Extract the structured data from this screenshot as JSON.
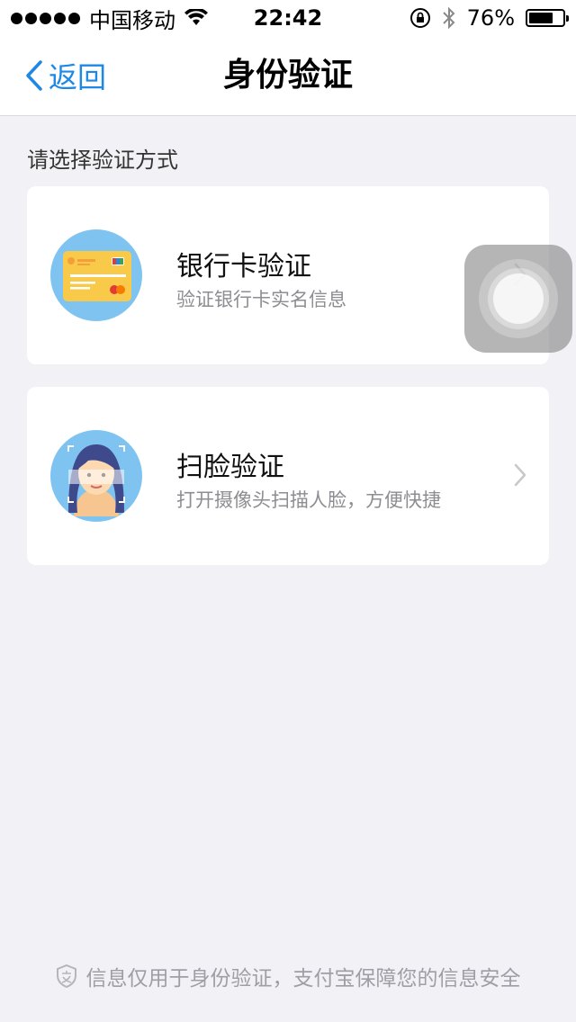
{
  "status_bar": {
    "carrier": "中国移动",
    "time": "22:42",
    "battery_percent": "76%",
    "battery_level": 0.76
  },
  "nav": {
    "back_label": "返回",
    "title": "身份验证"
  },
  "section_label": "请选择验证方式",
  "options": [
    {
      "title": "银行卡验证",
      "description": "验证银行卡实名信息",
      "icon": "bank-card-icon"
    },
    {
      "title": "扫脸验证",
      "description": "打开摄像头扫描人脸，方便快捷",
      "icon": "face-scan-icon"
    }
  ],
  "footer": {
    "text": "信息仅用于身份验证，支付宝保障您的信息安全",
    "icon": "shield-icon"
  },
  "colors": {
    "accent": "#1e88e5",
    "background": "#f2f2f6",
    "card": "#ffffff",
    "icon_circle": "#7fc4f1",
    "card_yellow": "#f9c94a"
  }
}
